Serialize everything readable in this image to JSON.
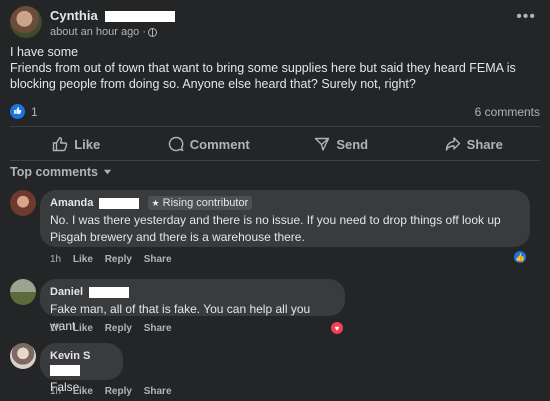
{
  "post": {
    "author": "Cynthia",
    "time": "about an hour ago",
    "body_line1": "I have some",
    "body_line2": "Friends from out of town that want to bring some supplies here but said they heard FEMA is",
    "body_line3": "blocking people from doing so. Anyone else heard that? Surely not, right?",
    "reaction_count": "1",
    "comment_count": "6 comments"
  },
  "actions": {
    "like": "Like",
    "comment": "Comment",
    "send": "Send",
    "share": "Share"
  },
  "comments_header": "Top comments",
  "comments": [
    {
      "name": "Amanda",
      "badge": "Rising contributor",
      "text_line1": "No. I was there yesterday and there is no issue. If you need to drop things off look up",
      "text_line2": "Pisgah brewery and there is a warehouse there.",
      "time": "1h",
      "like": "Like",
      "reply": "Reply",
      "share": "Share"
    },
    {
      "name": "Daniel",
      "text": "Fake man, all of that is fake. You can help all you want",
      "time": "1h",
      "like": "Like",
      "reply": "Reply",
      "share": "Share"
    },
    {
      "name": "Kevin S",
      "text": "False",
      "time": "1h",
      "like": "Like",
      "reply": "Reply",
      "share": "Share"
    }
  ],
  "colors": {
    "background": "#242526",
    "bubble": "#3a3b3c",
    "like_blue": "#1b74e4",
    "love_red": "#f33e58"
  }
}
